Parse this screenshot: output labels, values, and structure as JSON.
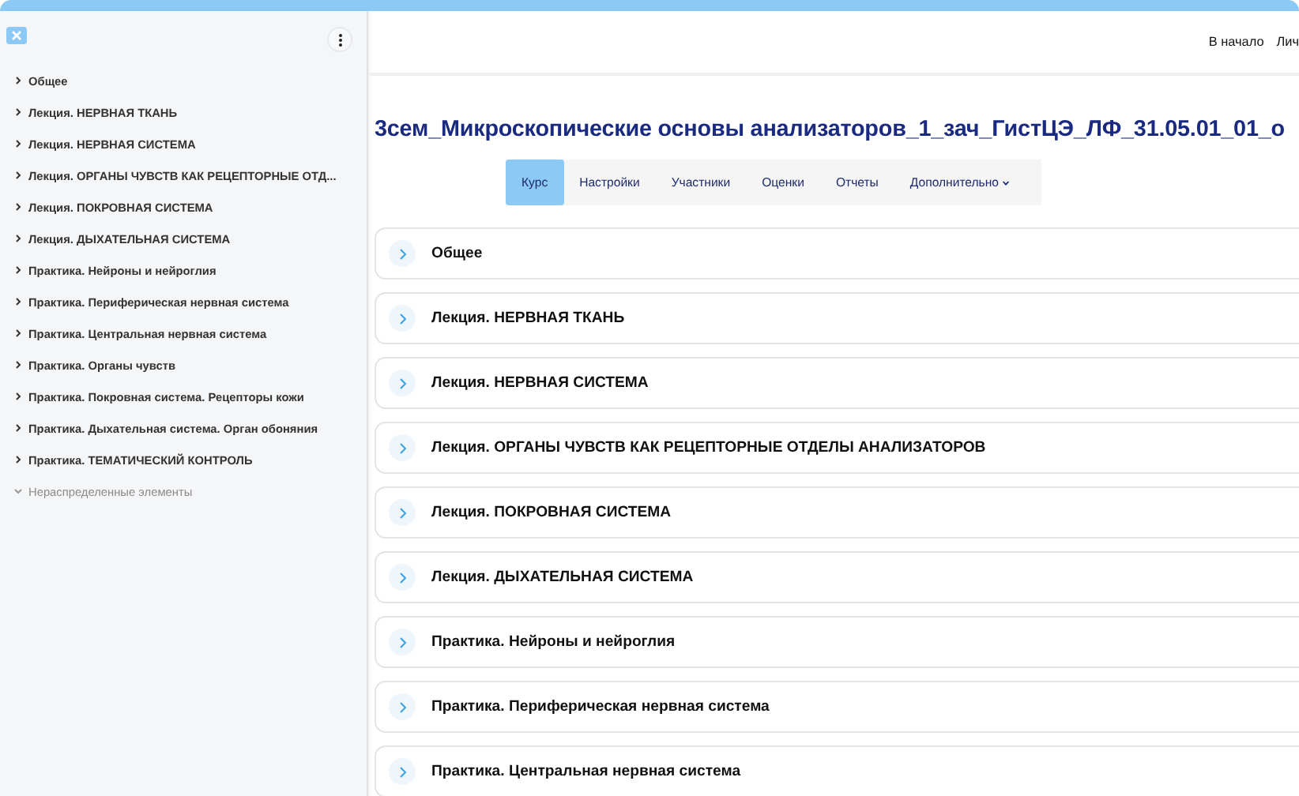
{
  "sidebar": {
    "items": [
      {
        "label": "Общее",
        "expanded": false,
        "dimmed": false
      },
      {
        "label": "Лекция. НЕРВНАЯ ТКАНЬ",
        "expanded": false,
        "dimmed": false
      },
      {
        "label": "Лекция. НЕРВНАЯ СИСТЕМА",
        "expanded": false,
        "dimmed": false
      },
      {
        "label": "Лекция. ОРГАНЫ ЧУВСТВ КАК РЕЦЕПТОРНЫЕ ОТД...",
        "expanded": false,
        "dimmed": false
      },
      {
        "label": "Лекция. ПОКРОВНАЯ СИСТЕМА",
        "expanded": false,
        "dimmed": false
      },
      {
        "label": "Лекция. ДЫХАТЕЛЬНАЯ СИСТЕМА",
        "expanded": false,
        "dimmed": false
      },
      {
        "label": "Практика. Нейроны и нейроглия",
        "expanded": false,
        "dimmed": false
      },
      {
        "label": "Практика. Периферическая нервная система",
        "expanded": false,
        "dimmed": false
      },
      {
        "label": "Практика. Центральная нервная система",
        "expanded": false,
        "dimmed": false
      },
      {
        "label": "Практика. Органы чувств",
        "expanded": false,
        "dimmed": false
      },
      {
        "label": "Практика. Покровная система. Рецепторы кожи",
        "expanded": false,
        "dimmed": false
      },
      {
        "label": "Практика. Дыхательная система. Орган обоняния",
        "expanded": false,
        "dimmed": false
      },
      {
        "label": "Практика. ТЕМАТИЧЕСКИЙ КОНТРОЛЬ",
        "expanded": false,
        "dimmed": false
      },
      {
        "label": "Нераспределенные элементы",
        "expanded": true,
        "dimmed": true
      }
    ]
  },
  "header": {
    "links": [
      "В начало",
      "Лич"
    ]
  },
  "course_title": "3сем_Микроскопические основы анализаторов_1_зач_ГистЦЭ_ЛФ_31.05.01_01_о",
  "tabs": [
    {
      "label": "Курс",
      "selected": true,
      "dropdown": false
    },
    {
      "label": "Настройки",
      "selected": false,
      "dropdown": false
    },
    {
      "label": "Участники",
      "selected": false,
      "dropdown": false
    },
    {
      "label": "Оценки",
      "selected": false,
      "dropdown": false
    },
    {
      "label": "Отчеты",
      "selected": false,
      "dropdown": false
    },
    {
      "label": "Дополнительно",
      "selected": false,
      "dropdown": true
    }
  ],
  "sections": [
    {
      "title": "Общее"
    },
    {
      "title": "Лекция. НЕРВНАЯ ТКАНЬ"
    },
    {
      "title": "Лекция. НЕРВНАЯ СИСТЕМА"
    },
    {
      "title": "Лекция. ОРГАНЫ ЧУВСТВ КАК РЕЦЕПТОРНЫЕ ОТДЕЛЫ АНАЛИЗАТОРОВ"
    },
    {
      "title": "Лекция. ПОКРОВНАЯ СИСТЕМА"
    },
    {
      "title": "Лекция. ДЫХАТЕЛЬНАЯ СИСТЕМА"
    },
    {
      "title": "Практика. Нейроны и нейроглия"
    },
    {
      "title": "Практика. Периферическая нервная система"
    },
    {
      "title": "Практика. Центральная нервная система"
    }
  ]
}
